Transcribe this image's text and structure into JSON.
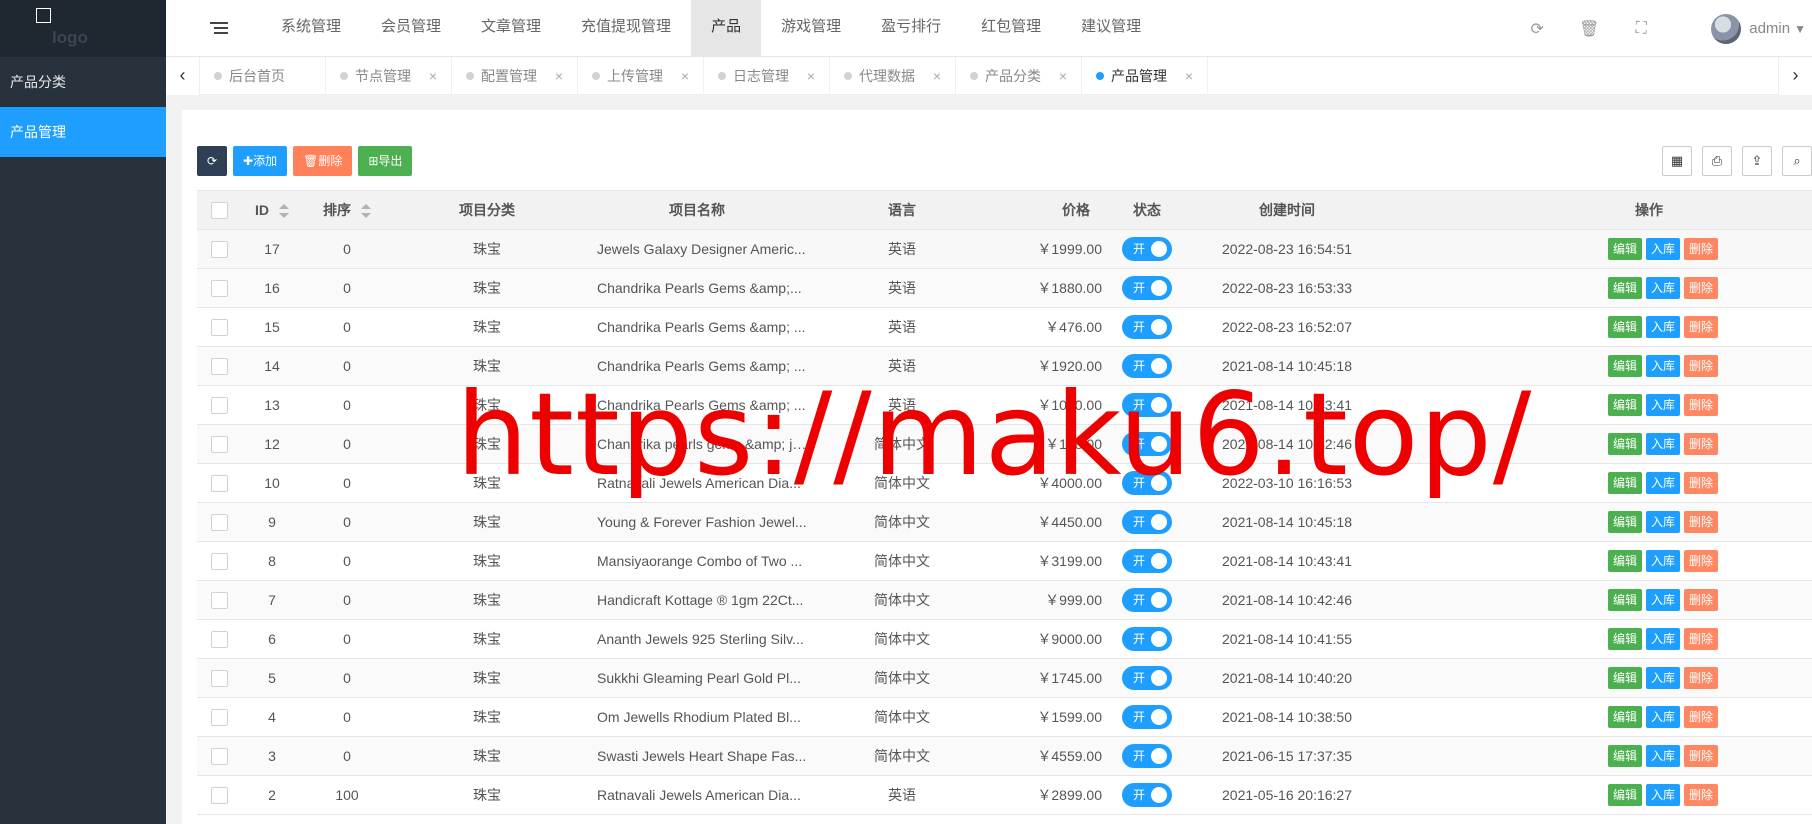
{
  "sidebar": {
    "logo": "logo",
    "items": [
      {
        "label": "产品分类"
      },
      {
        "label": "产品管理"
      }
    ]
  },
  "topnav": [
    {
      "label": "系统管理"
    },
    {
      "label": "会员管理"
    },
    {
      "label": "文章管理"
    },
    {
      "label": "充值提现管理"
    },
    {
      "label": "产品"
    },
    {
      "label": "游戏管理"
    },
    {
      "label": "盈亏排行"
    },
    {
      "label": "红包管理"
    },
    {
      "label": "建议管理"
    }
  ],
  "header": {
    "user": "admin"
  },
  "tabs": [
    {
      "label": "后台首页"
    },
    {
      "label": "节点管理"
    },
    {
      "label": "配置管理"
    },
    {
      "label": "上传管理"
    },
    {
      "label": "日志管理"
    },
    {
      "label": "代理数据"
    },
    {
      "label": "产品分类"
    },
    {
      "label": "产品管理"
    }
  ],
  "toolbar": {
    "add_label": "添加",
    "delete_label": "删除",
    "export_label": "导出"
  },
  "table": {
    "headers": {
      "id": "ID",
      "sort": "排序",
      "category": "项目分类",
      "name": "项目名称",
      "lang": "语言",
      "price": "价格",
      "status": "状态",
      "created": "创建时间",
      "actions": "操作"
    },
    "switch_label": "开",
    "action_labels": {
      "edit": "编辑",
      "stock": "入库",
      "del": "删除"
    },
    "rows": [
      {
        "id": "17",
        "sort": "0",
        "category": "珠宝",
        "name": "Jewels Galaxy Designer Americ...",
        "lang": "英语",
        "price": "￥1999.00",
        "created": "2022-08-23 16:54:51"
      },
      {
        "id": "16",
        "sort": "0",
        "category": "珠宝",
        "name": "Chandrika Pearls Gems &amp;...",
        "lang": "英语",
        "price": "￥1880.00",
        "created": "2022-08-23 16:53:33"
      },
      {
        "id": "15",
        "sort": "0",
        "category": "珠宝",
        "name": "Chandrika Pearls Gems &amp; ...",
        "lang": "英语",
        "price": "￥476.00",
        "created": "2022-08-23 16:52:07"
      },
      {
        "id": "14",
        "sort": "0",
        "category": "珠宝",
        "name": "Chandrika Pearls Gems &amp; ...",
        "lang": "英语",
        "price": "￥1920.00",
        "created": "2021-08-14 10:45:18"
      },
      {
        "id": "13",
        "sort": "0",
        "category": "珠宝",
        "name": "Chandrika Pearls Gems &amp; ...",
        "lang": "英语",
        "price": "￥1060.00",
        "created": "2021-08-14 10:43:41"
      },
      {
        "id": "12",
        "sort": "0",
        "category": "珠宝",
        "name": "Chandrika pearls gems &amp; jewe...",
        "lang": "简体中文",
        "price": "￥178.00",
        "created": "2021-08-14 10:42:46"
      },
      {
        "id": "10",
        "sort": "0",
        "category": "珠宝",
        "name": "Ratnavali Jewels American Dia...",
        "lang": "简体中文",
        "price": "￥4000.00",
        "created": "2022-03-10 16:16:53"
      },
      {
        "id": "9",
        "sort": "0",
        "category": "珠宝",
        "name": "Young & Forever Fashion Jewel...",
        "lang": "简体中文",
        "price": "￥4450.00",
        "created": "2021-08-14 10:45:18"
      },
      {
        "id": "8",
        "sort": "0",
        "category": "珠宝",
        "name": "Mansiyaorange Combo of Two ...",
        "lang": "简体中文",
        "price": "￥3199.00",
        "created": "2021-08-14 10:43:41"
      },
      {
        "id": "7",
        "sort": "0",
        "category": "珠宝",
        "name": "Handicraft Kottage ® 1gm 22Ct...",
        "lang": "简体中文",
        "price": "￥999.00",
        "created": "2021-08-14 10:42:46"
      },
      {
        "id": "6",
        "sort": "0",
        "category": "珠宝",
        "name": "Ananth Jewels 925 Sterling Silv...",
        "lang": "简体中文",
        "price": "￥9000.00",
        "created": "2021-08-14 10:41:55"
      },
      {
        "id": "5",
        "sort": "0",
        "category": "珠宝",
        "name": "Sukkhi Gleaming Pearl Gold Pl...",
        "lang": "简体中文",
        "price": "￥1745.00",
        "created": "2021-08-14 10:40:20"
      },
      {
        "id": "4",
        "sort": "0",
        "category": "珠宝",
        "name": "Om Jewells Rhodium Plated Bl...",
        "lang": "简体中文",
        "price": "￥1599.00",
        "created": "2021-08-14 10:38:50"
      },
      {
        "id": "3",
        "sort": "0",
        "category": "珠宝",
        "name": "Swasti Jewels Heart Shape Fas...",
        "lang": "简体中文",
        "price": "￥4559.00",
        "created": "2021-06-15 17:37:35"
      },
      {
        "id": "2",
        "sort": "100",
        "category": "珠宝",
        "name": "Ratnavali Jewels American Dia...",
        "lang": "英语",
        "price": "￥2899.00",
        "created": "2021-05-16 20:16:27"
      }
    ]
  },
  "watermark": "https://maku6.top/",
  "icons": {
    "refresh": "refresh-icon",
    "trash": "trash-icon",
    "fullscreen": "fullscreen-icon",
    "columns": "columns-icon",
    "print": "print-icon",
    "export": "export-icon",
    "search": "search-icon"
  },
  "colors": {
    "sidebar": "#28323d",
    "accent": "#1e9fff",
    "edit": "#4caf50",
    "delete": "#ff5722"
  }
}
